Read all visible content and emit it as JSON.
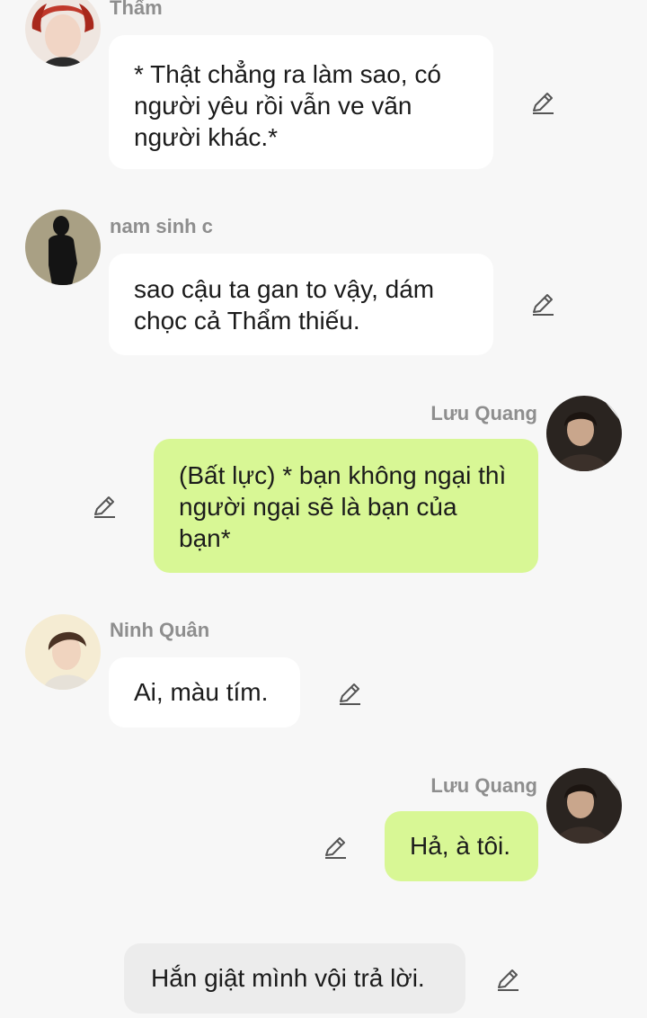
{
  "messages": [
    {
      "sender": "Thẩm",
      "text": "* Thật chẳng ra làm sao, có người yêu rồi vẫn ve vãn người khác.*",
      "side": "left"
    },
    {
      "sender": "nam sinh c",
      "text": "sao cậu ta gan to vậy, dám chọc cả Thẩm thiếu.",
      "side": "left"
    },
    {
      "sender": "Lưu Quang",
      "text": "(Bất lực) * bạn không ngại thì người ngại sẽ là bạn của bạn*",
      "side": "right"
    },
    {
      "sender": "Ninh Quân",
      "text": "Ai, màu tím.",
      "side": "left"
    },
    {
      "sender": "Lưu Quang",
      "text": "Hả, à tôi.",
      "side": "right"
    }
  ],
  "narration": {
    "text": "Hắn giật mình vội trả lời."
  },
  "colors": {
    "background": "#f7f7f7",
    "left_bubble": "#ffffff",
    "right_bubble": "#d8f795",
    "narration_bubble": "#ececec",
    "name_text": "#8e8e8e"
  },
  "icons": [
    "edit-pencil-icon"
  ]
}
